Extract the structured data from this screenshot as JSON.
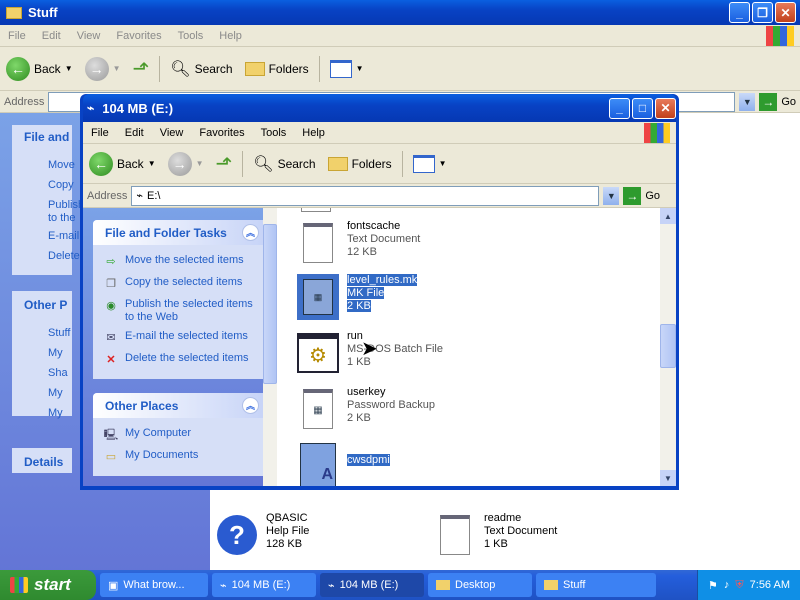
{
  "back_window": {
    "title": "Stuff",
    "menu": [
      "File",
      "Edit",
      "View",
      "Favorites",
      "Tools",
      "Help"
    ],
    "toolbar": {
      "back": "Back",
      "search": "Search",
      "folders": "Folders"
    },
    "address_label": "Address",
    "go": "Go",
    "left_fragments": [
      "File and",
      "Move",
      "Copy",
      "Publish",
      "to the",
      "E-mail",
      "Delete",
      "Other P",
      "Stuff",
      "My",
      "Sha",
      "My",
      "My",
      "Details"
    ],
    "files": [
      {
        "name": "QBASIC",
        "type": "Help File",
        "size": "128 KB"
      },
      {
        "name": "readme",
        "type": "Text Document",
        "size": "1 KB"
      }
    ]
  },
  "front_window": {
    "title": "104 MB (E:)",
    "menu": [
      "File",
      "Edit",
      "View",
      "Favorites",
      "Tools",
      "Help"
    ],
    "toolbar": {
      "back": "Back",
      "search": "Search",
      "folders": "Folders"
    },
    "address_label": "Address",
    "address_value": "E:\\",
    "go": "Go",
    "tasks_panel": {
      "title": "File and Folder Tasks",
      "items": [
        {
          "label": "Move the selected items",
          "icon": "move-icon"
        },
        {
          "label": "Copy the selected items",
          "icon": "copy-icon"
        },
        {
          "label": "Publish the selected items to the Web",
          "icon": "globe-icon"
        },
        {
          "label": "E-mail the selected items",
          "icon": "email-icon"
        },
        {
          "label": "Delete the selected items",
          "icon": "delete-icon"
        }
      ]
    },
    "places_panel": {
      "title": "Other Places",
      "items": [
        {
          "label": "My Computer"
        },
        {
          "label": "My Documents"
        }
      ]
    },
    "files": [
      {
        "name": "fontscache",
        "type": "Text Document",
        "size": "12 KB",
        "selected": false
      },
      {
        "name": "level_rules.mk",
        "type": "MK File",
        "size": "2 KB",
        "selected": true
      },
      {
        "name": "run",
        "type": "MS-DOS Batch File",
        "size": "1 KB",
        "selected": false
      },
      {
        "name": "userkey",
        "type": "Password Backup",
        "size": "2 KB",
        "selected": false
      },
      {
        "name": "cwsdpmi",
        "type": "",
        "size": "",
        "selected": true
      }
    ]
  },
  "taskbar": {
    "start": "start",
    "items": [
      {
        "label": "What brow...",
        "active": false
      },
      {
        "label": "104 MB (E:)",
        "active": false
      },
      {
        "label": "104 MB (E:)",
        "active": true
      },
      {
        "label": "Desktop",
        "active": false
      },
      {
        "label": "Stuff",
        "active": false
      }
    ],
    "clock": "7:56 AM"
  }
}
